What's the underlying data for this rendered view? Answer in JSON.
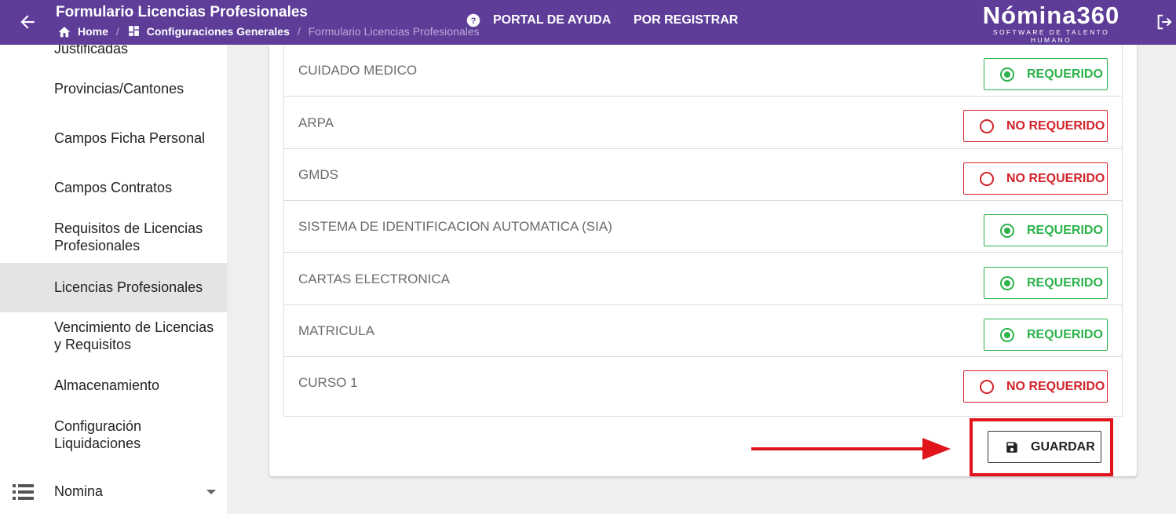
{
  "header": {
    "title": "Formulario Licencias Profesionales",
    "breadcrumb": [
      "Home",
      "Configuraciones Generales",
      "Formulario Licencias Profesionales"
    ],
    "nav": {
      "help": "PORTAL DE AYUDA",
      "register": "POR REGISTRAR"
    },
    "logo": {
      "main": "Nómina360",
      "sub": "SOFTWARE DE TALENTO HUMANO"
    },
    "color": "#5e3d99"
  },
  "sidebar": {
    "items": [
      {
        "label": "Justificadas"
      },
      {
        "label": "Provincias/Cantones"
      },
      {
        "label": "Campos Ficha Personal"
      },
      {
        "label": "Campos Contratos"
      },
      {
        "label": "Requisitos de Licencias Profesionales"
      },
      {
        "label": "Licencias Profesionales",
        "active": true
      },
      {
        "label": "Vencimiento de Licencias y Requisitos"
      },
      {
        "label": "Almacenamiento"
      },
      {
        "label": "Configuración Liquidaciones"
      }
    ],
    "group": {
      "label": "Nomina",
      "icon": "list-icon"
    }
  },
  "requirements": [
    {
      "name": "CUIDADO MEDICO",
      "status": "REQUERIDO",
      "required": true
    },
    {
      "name": "ARPA",
      "status": "NO REQUERIDO",
      "required": false
    },
    {
      "name": "GMDS",
      "status": "NO REQUERIDO",
      "required": false
    },
    {
      "name": "SISTEMA DE IDENTIFICACION AUTOMATICA (SIA)",
      "status": "REQUERIDO",
      "required": true
    },
    {
      "name": "CARTAS ELECTRONICA",
      "status": "REQUERIDO",
      "required": true
    },
    {
      "name": "MATRICULA",
      "status": "REQUERIDO",
      "required": true
    },
    {
      "name": "CURSO 1",
      "status": "NO REQUERIDO",
      "required": false
    }
  ],
  "colors": {
    "required": "#2bb34a",
    "not_required": "#d3232a",
    "highlight": "#e0141b"
  },
  "actions": {
    "save": "GUARDAR"
  }
}
